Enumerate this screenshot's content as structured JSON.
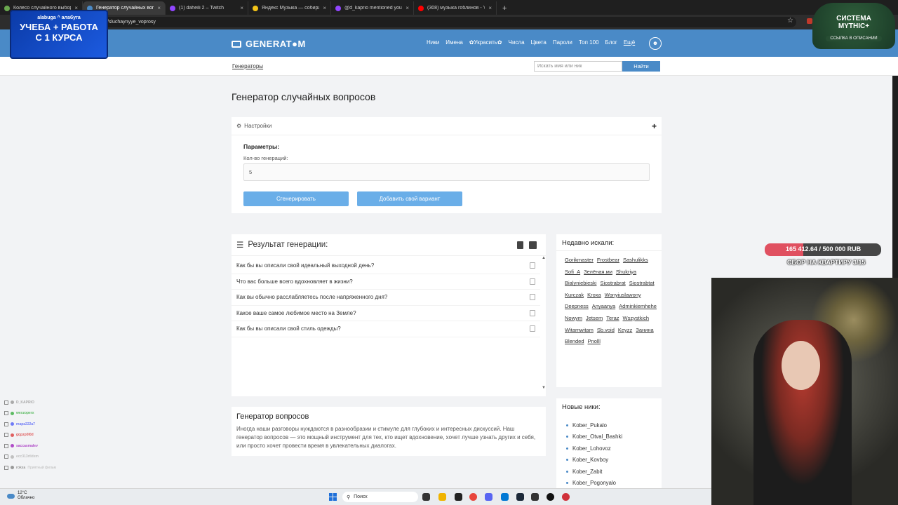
{
  "browser": {
    "tabs": [
      {
        "label": "Колесо случайного выбора",
        "color": "#6aa84f",
        "active": false
      },
      {
        "label": "Генератор случайных вопрос",
        "color": "#4a8ac7",
        "active": true
      },
      {
        "label": "(1) daheili 2 – Twitch",
        "color": "#9146ff",
        "active": false
      },
      {
        "label": "Яндекс Музыка — собирает",
        "color": "#f5c518",
        "active": false
      },
      {
        "label": "@d_kaprio mentioned you",
        "color": "#9146ff",
        "active": false
      },
      {
        "label": "(308) музыка гоблинов - YouT",
        "color": "#ff0000",
        "active": false
      }
    ],
    "url": "/sluchaynyye_voprosy"
  },
  "overlay": {
    "promo_logos": "alabuga ^ алабуга",
    "promo_line1": "УЧЕБА + РАБОТА",
    "promo_line2": "С 1 КУРСА",
    "mythic_line1": "СИСТЕМА",
    "mythic_line2": "MYTHIC+",
    "mythic_sub": "ССЫЛКА В ОПИСАНИИ",
    "goal_amount": "165 412.64 / 500 000 RUB",
    "goal_fraction": 0.3308,
    "goal_label": "СБОР НА КВАРТИРУ 3/15",
    "chat": [
      {
        "name": "D_KAPRIO",
        "msg": "",
        "color": "#aaa"
      },
      {
        "name": "wexzoperx",
        "msg": "",
        "color": "#5dbb63"
      },
      {
        "name": "mapa222a7",
        "msg": "",
        "color": "#6f7bf7"
      },
      {
        "name": "gqpzp0l0d",
        "msg": "",
        "color": "#e06060"
      },
      {
        "name": "saccasmalev",
        "msg": "",
        "color": "#b04cc8"
      },
      {
        "name": "ecc313rtldxm",
        "msg": "",
        "color": "#c0c0c0"
      },
      {
        "name": "rokxa",
        "msg": "Приятный фильм",
        "color": "#999"
      }
    ]
  },
  "site": {
    "logo": "GENERAT●M",
    "nav": [
      "Ники",
      "Имена",
      "✿Украсить✿",
      "Числа",
      "Цвета",
      "Пароли",
      "Топ 100",
      "Блог",
      "Ещё"
    ],
    "breadcrumb": "Генераторы",
    "search_placeholder": "Искать имя или ник",
    "search_button": "Найти",
    "page_title": "Генератор случайных вопросов",
    "settings": {
      "title": "Настройки",
      "params_label": "Параметры:",
      "count_label": "Кол-во генераций:",
      "count_value": "5",
      "generate_button": "Сгенерировать",
      "add_button": "Добавить свой вариант"
    },
    "results": {
      "title": "Результат генерации:",
      "items": [
        "Как бы вы описали свой идеальный выходной день?",
        "Что вас больше всего вдохновляет в жизни?",
        "Как вы обычно расслабляетесь после напряженного дня?",
        "Какое ваше самое любимое место на Земле?",
        "Как бы вы описали свой стиль одежды?"
      ]
    },
    "about": {
      "title": "Генератор вопросов",
      "text": "Иногда наши разговоры нуждаются в разнообразии и стимуле для глубоких и интересных дискуссий. Наш генератор вопросов — это мощный инструмент для тех, кто ищет вдохновение, хочет лучше узнать других и себя, или просто хочет провести время в увлекательных диалогах."
    },
    "recent": {
      "title": "Недавно искали:",
      "tags": [
        "Gorikmaster",
        "Frostbear",
        "Sashulikks",
        "Sofi_A",
        "Зелёная.ми",
        "Shukriya",
        "Bialyniebieski",
        "Siostrabrat",
        "Siostrabtat",
        "Kurczak",
        "Kroxa",
        "Wonyiuslawony",
        "Deepness",
        "Anyaanya",
        "Adminkiemhehe",
        "Nowym",
        "Jetsem",
        "Teraz",
        "Wszystkich",
        "Witamwitam",
        "Sb.void",
        "Keyzz",
        "Занина",
        "Blended",
        "Pnolll"
      ]
    },
    "new_nicks": {
      "title": "Новые ники:",
      "items": [
        "Kober_Pukalo",
        "Kober_Otval_Bashki",
        "Kober_Lohovoz",
        "Kober_Kovboy",
        "Kober_Zabit",
        "Kober_Pogonyalo"
      ]
    }
  },
  "taskbar": {
    "temp": "12°C",
    "condition": "Облачно",
    "search": "Поиск"
  }
}
